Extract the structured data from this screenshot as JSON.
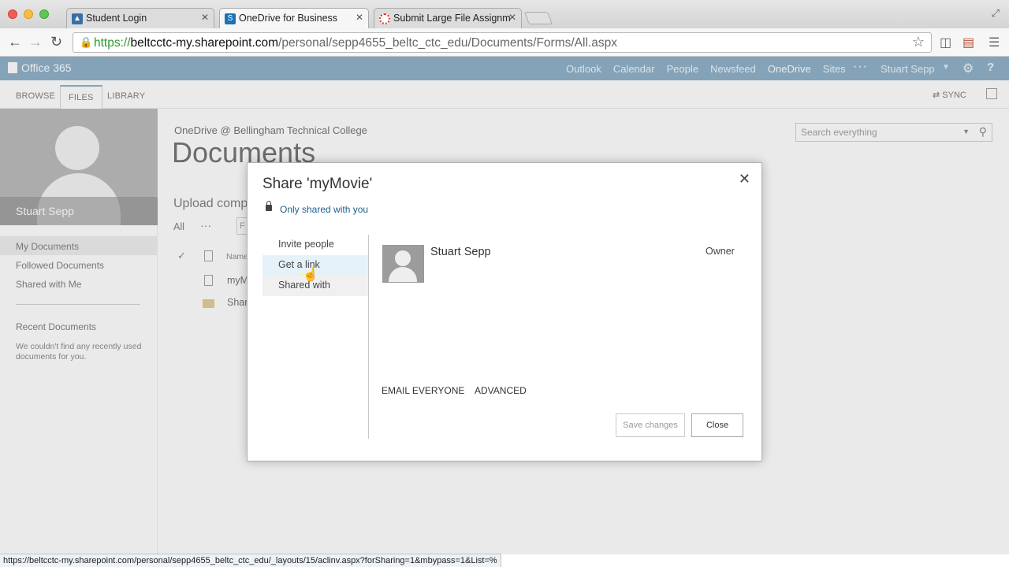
{
  "browser": {
    "tabs": [
      {
        "title": "Student Login",
        "favicon": "student-login-favicon"
      },
      {
        "title": "OneDrive for Business",
        "favicon": "sharepoint-favicon"
      },
      {
        "title": "Submit Large File Assignm",
        "favicon": "assignment-favicon"
      }
    ],
    "url_https": "https://",
    "url_host": "beltcctc-my.sharepoint.com",
    "url_path": "/personal/sepp4655_beltc_ctc_edu/Documents/Forms/All.aspx",
    "status_url": "https://beltcctc-my.sharepoint.com/personal/sepp4655_beltc_ctc_edu/_layouts/15/aclinv.aspx?forSharing=1&mbypass=1&List=%"
  },
  "suite": {
    "brand": "Office 365",
    "nav": [
      "Outlook",
      "Calendar",
      "People",
      "Newsfeed",
      "OneDrive",
      "Sites"
    ],
    "more": "···",
    "user": "Stuart Sepp",
    "accent": "#5b8db1"
  },
  "ribbon": {
    "tabs": [
      "BROWSE",
      "FILES",
      "LIBRARY"
    ],
    "sync": "SYNC"
  },
  "leftnav": {
    "profile_name": "Stuart Sepp",
    "items": [
      "My Documents",
      "Followed Documents",
      "Shared with Me"
    ],
    "recent_heading": "Recent Documents",
    "recent_empty": "We couldn't find any recently used documents for you."
  },
  "main": {
    "site": "OneDrive @ Bellingham Technical College",
    "title": "Documents",
    "upload": "Upload comple",
    "view_all": "All",
    "view_more": "···",
    "find": "F",
    "col_name": "Name",
    "rows": [
      "myM",
      "Shar"
    ],
    "search_placeholder": "Search everything"
  },
  "dialog": {
    "title": "Share 'myMovie'",
    "sharing_state": "Only shared with you",
    "side_items": [
      "Invite people",
      "Get a link",
      "Shared with"
    ],
    "user_name": "Stuart Sepp",
    "user_role": "Owner",
    "email_everyone": "EMAIL EVERYONE",
    "advanced": "ADVANCED",
    "save_label": "Save changes",
    "close_label": "Close"
  }
}
